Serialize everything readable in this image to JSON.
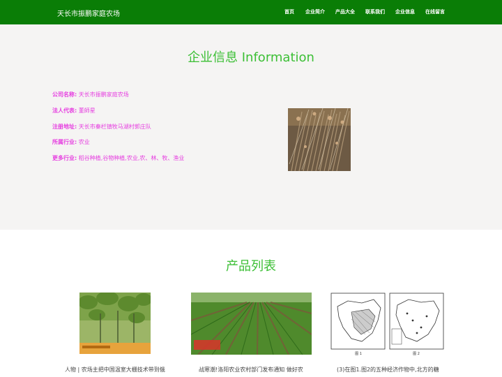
{
  "header": {
    "brand": "天长市振鹏家庭农场",
    "nav": [
      {
        "label": "首页"
      },
      {
        "label": "企业简介"
      },
      {
        "label": "产品大全"
      },
      {
        "label": "联系我们"
      },
      {
        "label": "企业信息"
      },
      {
        "label": "在线留言"
      }
    ]
  },
  "company": {
    "title": "企业信息 Information",
    "fields": [
      {
        "label": "公司名称:",
        "value": "天长市振鹏家庭农场"
      },
      {
        "label": "法人代表:",
        "value": "董師星"
      },
      {
        "label": "注册地址:",
        "value": "天长市秦栏镇牧马湖村郭庄队"
      },
      {
        "label": "所属行业:",
        "value": "农业"
      },
      {
        "label": "更多行业:",
        "value": "稻谷种植,谷物种植,农业,农、林、牧、渔业"
      }
    ]
  },
  "products": {
    "title": "产品列表",
    "items": [
      {
        "caption": "人物 | 农场主把中国温室大棚技术带到俄"
      },
      {
        "caption": "战寒潮!洛阳农业农村部门发布通知 做好农"
      },
      {
        "caption": "(3)在图1.图2的五种经济作物中,北方的糖"
      }
    ],
    "map_labels": [
      "图 1",
      "图 2"
    ]
  },
  "colors": {
    "nav_bg": "#0a7d06",
    "title_green": "#3cbf35",
    "info_magenta": "#e63ee0",
    "section_bg": "#f5f4f3"
  }
}
